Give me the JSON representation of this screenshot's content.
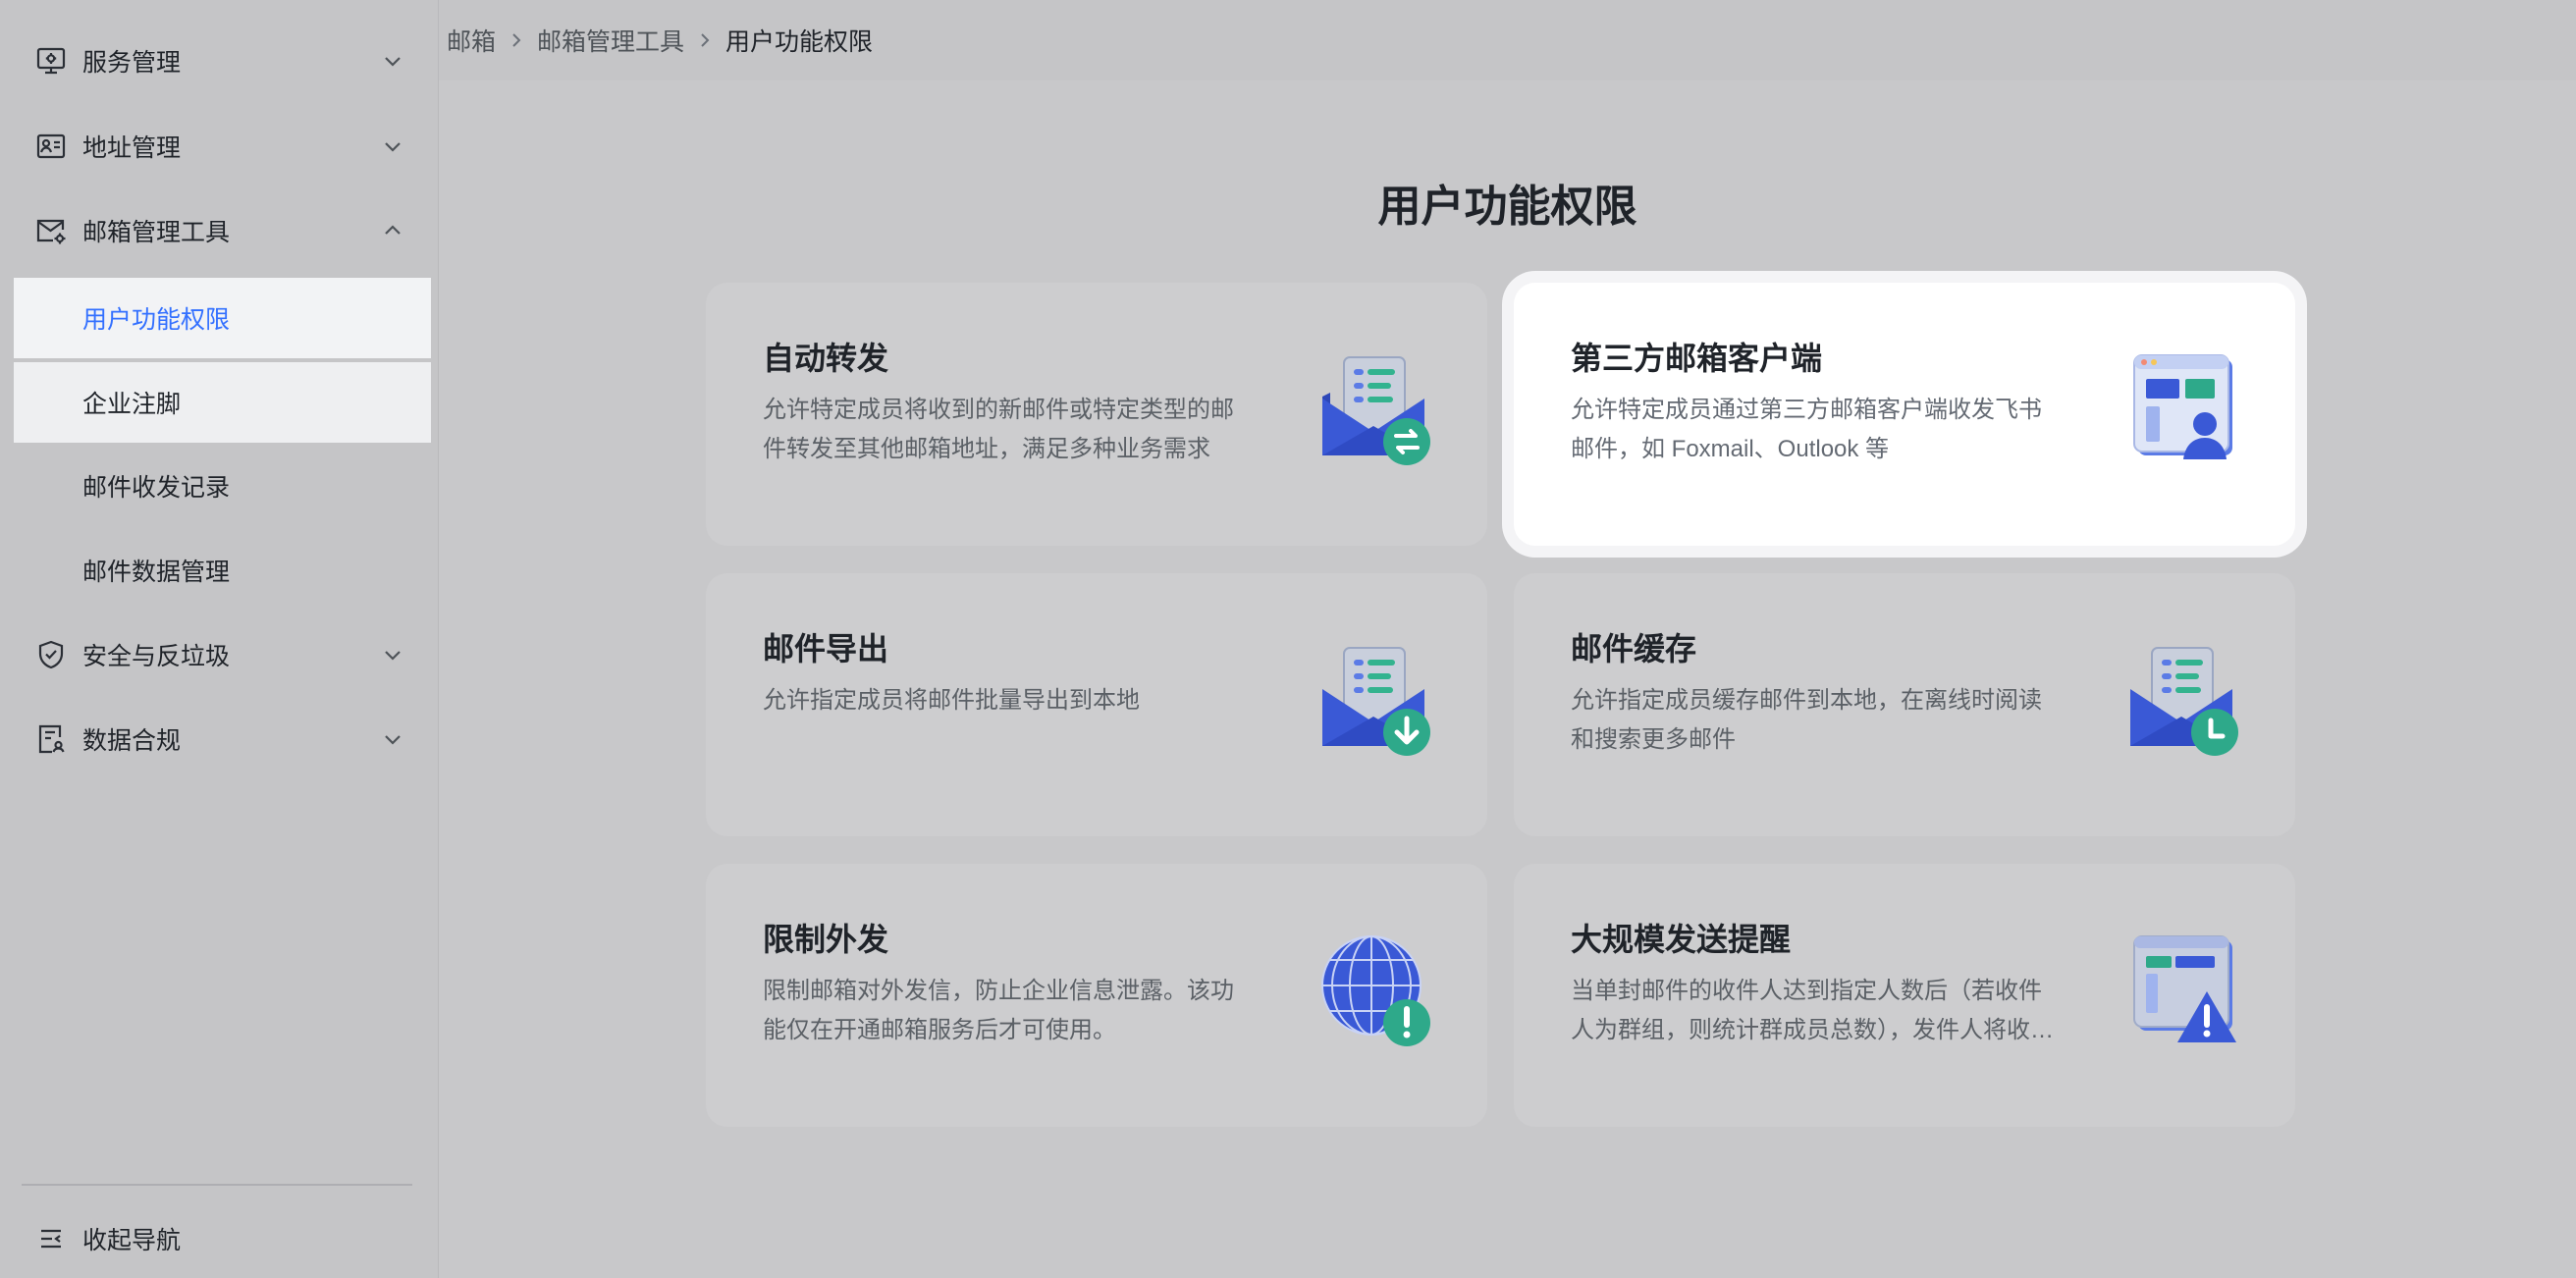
{
  "sidebar": {
    "groups": [
      {
        "label": "服务管理",
        "icon": "monitor-settings-icon",
        "expanded": false
      },
      {
        "label": "地址管理",
        "icon": "address-card-icon",
        "expanded": false
      },
      {
        "label": "邮箱管理工具",
        "icon": "mail-settings-icon",
        "expanded": true
      },
      {
        "label": "安全与反垃圾",
        "icon": "shield-check-icon",
        "expanded": false
      },
      {
        "label": "数据合规",
        "icon": "compliance-document-icon",
        "expanded": false
      }
    ],
    "sub_items": [
      {
        "label": "用户功能权限",
        "active": true
      },
      {
        "label": "企业注脚",
        "active": false
      },
      {
        "label": "邮件收发记录",
        "active": false
      },
      {
        "label": "邮件数据管理",
        "active": false
      }
    ],
    "collapse_label": "收起导航"
  },
  "breadcrumb": [
    "邮箱",
    "邮箱管理工具",
    "用户功能权限"
  ],
  "main": {
    "title": "用户功能权限",
    "cards": [
      {
        "title": "自动转发",
        "desc": "允许特定成员将收到的新邮件或特定类型的邮件转发至其他邮箱地址，满足多种业务需求",
        "icon": "mail-forward-icon"
      },
      {
        "title": "第三方邮箱客户端",
        "desc": "允许特定成员通过第三方邮箱客户端收发飞书邮件，如 Foxmail、Outlook 等",
        "icon": "third-party-client-icon"
      },
      {
        "title": "邮件导出",
        "desc": "允许指定成员将邮件批量导出到本地",
        "icon": "mail-export-icon"
      },
      {
        "title": "邮件缓存",
        "desc": "允许指定成员缓存邮件到本地，在离线时阅读和搜索更多邮件",
        "icon": "mail-cache-icon"
      },
      {
        "title": "限制外发",
        "desc": "限制邮箱对外发信，防止企业信息泄露。该功能仅在开通邮箱服务后才可使用。",
        "icon": "globe-warning-icon"
      },
      {
        "title": "大规模发送提醒",
        "desc": "当单封邮件的收件人达到指定人数后（若收件人为群组，则统计群成员总数），发件人将收到提醒",
        "icon": "bulk-send-warning-icon"
      }
    ]
  },
  "colors": {
    "accent": "#3370ff",
    "mail_blue": "#3a59d6",
    "badge_green": "#2ea98a"
  }
}
